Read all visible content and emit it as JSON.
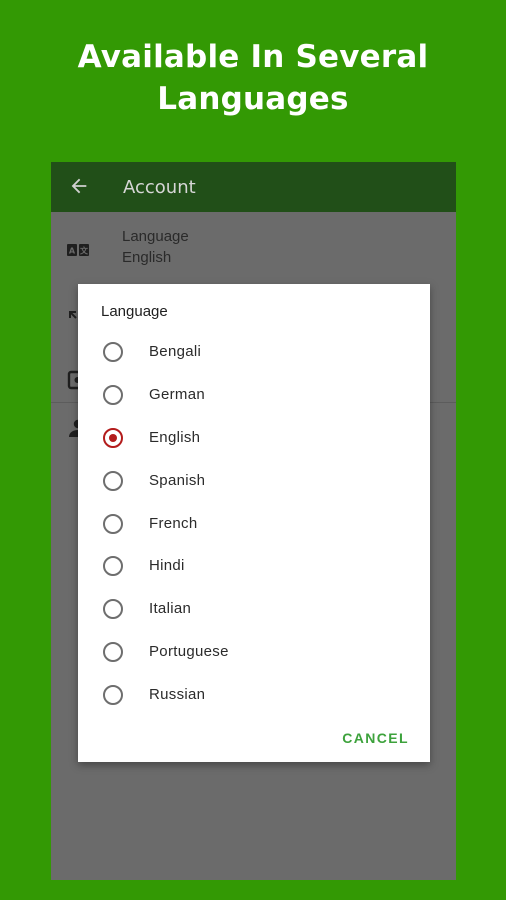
{
  "promo": {
    "line1": "Available In Several",
    "line2": "Languages"
  },
  "appbar": {
    "back_icon": "arrow-left-icon",
    "title": "Account"
  },
  "settings": {
    "language": {
      "icon": "translate-icon",
      "title": "Language",
      "value": "English"
    },
    "row2_icon": "expand-icon",
    "row3_icon": "switch-account-icon",
    "row4_icon": "person-icon"
  },
  "dialog": {
    "title": "Language",
    "options": [
      {
        "label": "Bengali",
        "checked": false
      },
      {
        "label": "German",
        "checked": false
      },
      {
        "label": "English",
        "checked": true
      },
      {
        "label": "Spanish",
        "checked": false
      },
      {
        "label": "French",
        "checked": false
      },
      {
        "label": "Hindi",
        "checked": false
      },
      {
        "label": "Italian",
        "checked": false
      },
      {
        "label": "Portuguese",
        "checked": false
      },
      {
        "label": "Russian",
        "checked": false
      }
    ],
    "cancel_label": "CANCEL"
  },
  "colors": {
    "background": "#339904",
    "appbar": "#214f18",
    "radio_selected": "#b31c1c",
    "accent_button": "#3da23c"
  }
}
